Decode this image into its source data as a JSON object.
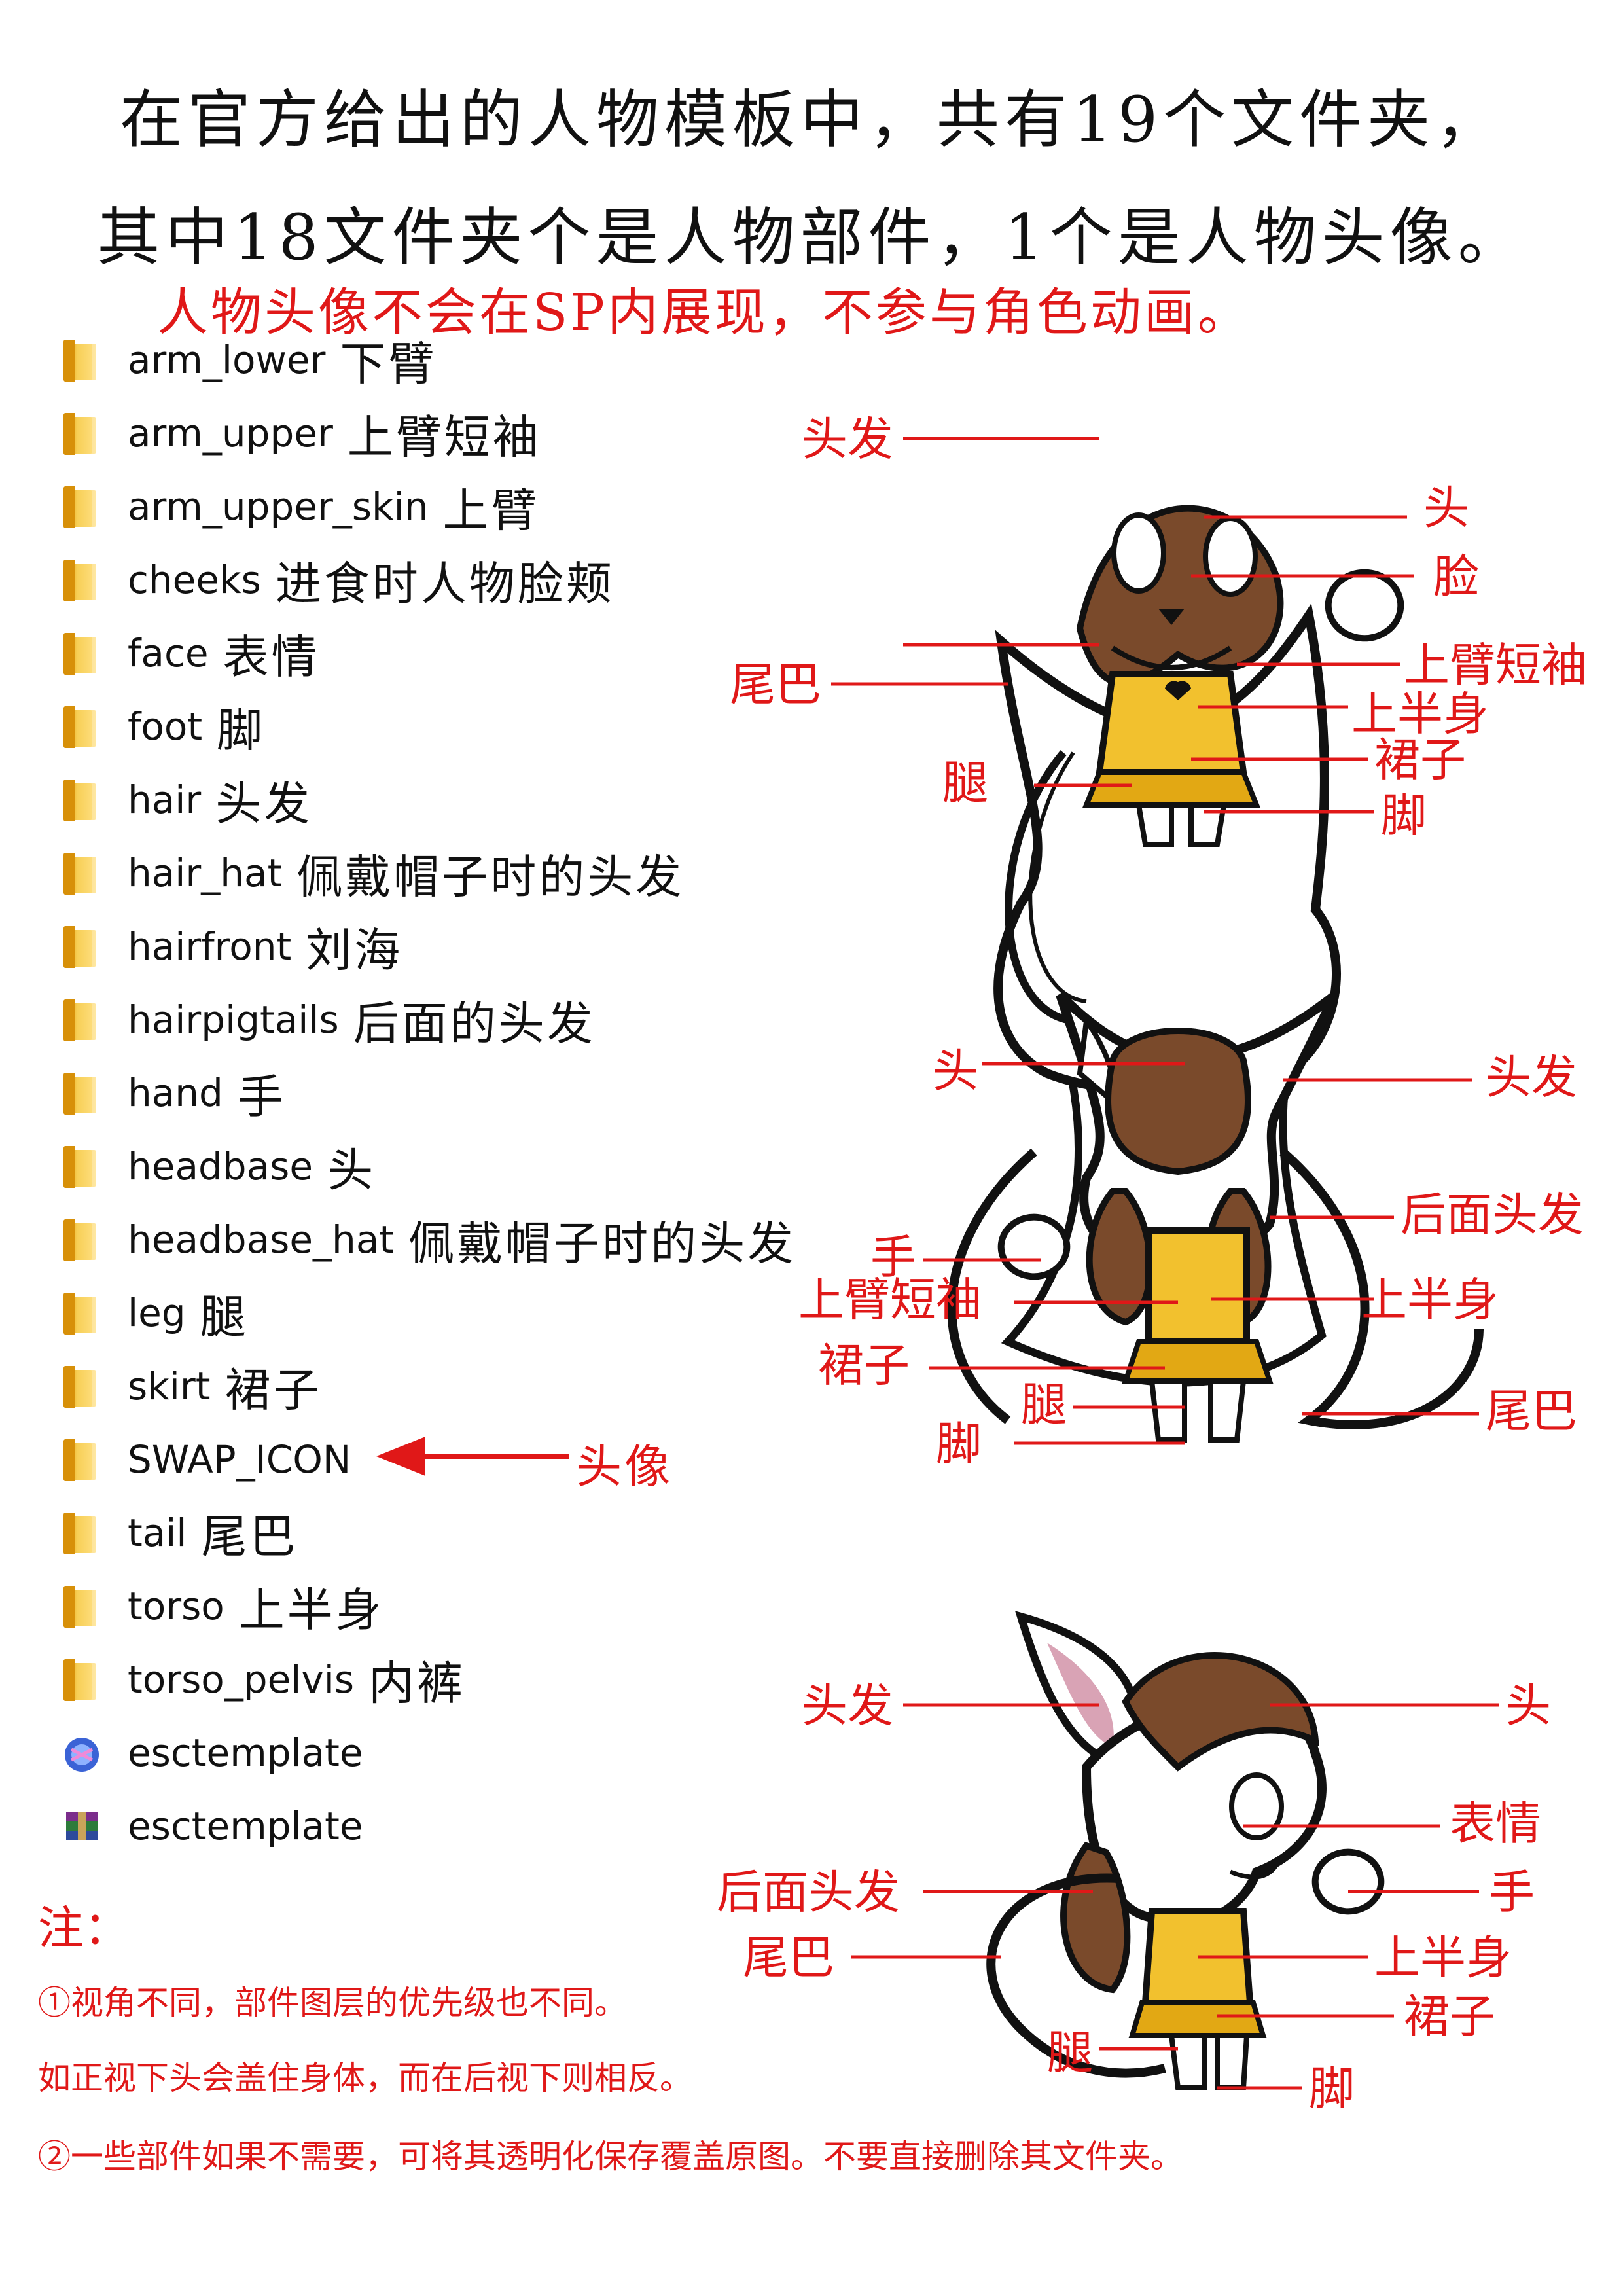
{
  "heading_line1": "在官方给出的人物模板中，共有19个文件夹，",
  "heading_line2": "其中18文件夹个是人物部件，1个是人物头像。",
  "subheading": "人物头像不会在SP内展现，不参与角色动画。",
  "folders": [
    {
      "name": "arm_lower",
      "label": "下臂",
      "icon": "folder-icon"
    },
    {
      "name": "arm_upper",
      "label": "上臂短袖",
      "icon": "folder-icon"
    },
    {
      "name": "arm_upper_skin",
      "label": "上臂",
      "icon": "folder-icon"
    },
    {
      "name": "cheeks",
      "label": "进食时人物脸颊",
      "icon": "folder-icon"
    },
    {
      "name": "face",
      "label": "表情",
      "icon": "folder-icon"
    },
    {
      "name": "foot",
      "label": "脚",
      "icon": "folder-icon"
    },
    {
      "name": "hair",
      "label": "头发",
      "icon": "folder-icon"
    },
    {
      "name": "hair_hat",
      "label": "佩戴帽子时的头发",
      "icon": "folder-icon"
    },
    {
      "name": "hairfront",
      "label": "刘海",
      "icon": "folder-icon"
    },
    {
      "name": "hairpigtails",
      "label": "后面的头发",
      "icon": "folder-icon"
    },
    {
      "name": "hand",
      "label": "手",
      "icon": "folder-icon"
    },
    {
      "name": "headbase",
      "label": "头",
      "icon": "folder-icon"
    },
    {
      "name": "headbase_hat",
      "label": "佩戴帽子时的头发",
      "icon": "folder-icon"
    },
    {
      "name": "leg",
      "label": "腿",
      "icon": "folder-icon"
    },
    {
      "name": "skirt",
      "label": "裙子",
      "icon": "folder-icon"
    },
    {
      "name": "SWAP_ICON",
      "label": "",
      "icon": "folder-icon"
    },
    {
      "name": "tail",
      "label": "尾巴",
      "icon": "folder-icon"
    },
    {
      "name": "torso",
      "label": "上半身",
      "icon": "folder-icon"
    },
    {
      "name": "torso_pelvis",
      "label": "内裤",
      "icon": "folder-icon"
    },
    {
      "name": "esctemplate",
      "label": "",
      "icon": "spriter-project-icon"
    },
    {
      "name": "esctemplate",
      "label": "",
      "icon": "rar-archive-icon"
    }
  ],
  "swap_icon_arrow_label": "头像",
  "diagram_front": {
    "labels": [
      "头发",
      "头",
      "脸",
      "上臂短袖",
      "尾巴",
      "上半身",
      "裙子",
      "腿",
      "脚"
    ]
  },
  "diagram_back": {
    "labels": [
      "头",
      "头发",
      "后面头发",
      "手",
      "上臂短袖",
      "上半身",
      "裙子",
      "腿",
      "尾巴",
      "脚"
    ]
  },
  "diagram_side": {
    "labels": [
      "头发",
      "头",
      "表情",
      "后面头发",
      "手",
      "尾巴",
      "上半身",
      "裙子",
      "腿",
      "脚"
    ]
  },
  "notes": {
    "title": "注：",
    "line1": "①视角不同，部件图层的优先级也不同。",
    "line2": "如正视下头会盖住身体，而在后视下则相反。",
    "line3": "②一些部件如果不需要，可将其透明化保存覆盖原图。不要直接删除其文件夹。"
  },
  "colors": {
    "accent": "#e01818",
    "folder": "#f2b92c"
  }
}
